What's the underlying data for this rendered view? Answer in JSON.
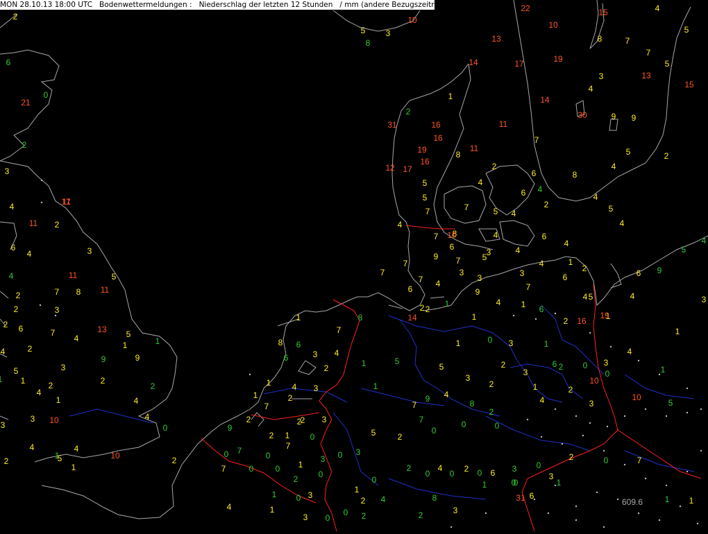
{
  "header": {
    "datetime": "MON 28.10.13 18:00 UTC",
    "report": "Bodenwettermeldungen :",
    "description": "Niederschlag der letzten 12 Stunden",
    "unit": "/ mm (andere Bezugszeiträume in GRAU)"
  },
  "colors": {
    "background": "#000000",
    "coastline": "#a8a8a8",
    "border_national": "#ff2020",
    "border_regional": "#2030c8",
    "low": "#33cc33",
    "mid": "#ffee22",
    "high": "#ff5522",
    "station_dot": "#bbbbbb",
    "grey": "#aaaaaa"
  },
  "station_values": [
    {
      "v": "2",
      "c": "mid"
    },
    {
      "v": "22",
      "c": "high"
    },
    {
      "v": "15",
      "c": "high"
    },
    {
      "v": "4",
      "c": "mid"
    },
    {
      "v": "10",
      "c": "high"
    },
    {
      "v": "5",
      "c": "mid"
    },
    {
      "v": "3",
      "c": "mid"
    },
    {
      "v": "8",
      "c": "low"
    },
    {
      "v": "6",
      "c": "low"
    },
    {
      "v": "5",
      "c": "mid"
    },
    {
      "v": "13",
      "c": "high"
    },
    {
      "v": "10",
      "c": "high"
    },
    {
      "v": "8",
      "c": "mid"
    },
    {
      "v": "7",
      "c": "mid"
    },
    {
      "v": "7",
      "c": "mid"
    },
    {
      "v": "5",
      "c": "mid"
    },
    {
      "v": "14",
      "c": "high"
    },
    {
      "v": "17",
      "c": "high"
    },
    {
      "v": "19",
      "c": "high"
    },
    {
      "v": "3",
      "c": "mid"
    },
    {
      "v": "13",
      "c": "high"
    },
    {
      "v": "4",
      "c": "mid"
    },
    {
      "v": "15",
      "c": "high"
    },
    {
      "v": "1",
      "c": "mid"
    },
    {
      "v": "14",
      "c": "high"
    },
    {
      "v": "21",
      "c": "high"
    },
    {
      "v": "0",
      "c": "low"
    },
    {
      "v": "2",
      "c": "low"
    },
    {
      "v": "30",
      "c": "high"
    },
    {
      "v": "9",
      "c": "mid"
    },
    {
      "v": "9",
      "c": "mid"
    },
    {
      "v": "7",
      "c": "mid"
    },
    {
      "v": "31",
      "c": "high"
    },
    {
      "v": "16",
      "c": "high"
    },
    {
      "v": "11",
      "c": "high"
    },
    {
      "v": "16",
      "c": "high"
    },
    {
      "v": "7",
      "c": "mid"
    },
    {
      "v": "2",
      "c": "low"
    },
    {
      "v": "19",
      "c": "high"
    },
    {
      "v": "11",
      "c": "high"
    },
    {
      "v": "5",
      "c": "mid"
    },
    {
      "v": "2",
      "c": "mid"
    },
    {
      "v": "8",
      "c": "mid"
    },
    {
      "v": "16",
      "c": "high"
    },
    {
      "v": "2",
      "c": "mid"
    },
    {
      "v": "12",
      "c": "high"
    },
    {
      "v": "17",
      "c": "high"
    },
    {
      "v": "4",
      "c": "mid"
    },
    {
      "v": "6",
      "c": "mid"
    },
    {
      "v": "8",
      "c": "mid"
    },
    {
      "v": "3",
      "c": "mid"
    },
    {
      "v": "17",
      "c": "high"
    },
    {
      "v": "5",
      "c": "mid"
    },
    {
      "v": "4",
      "c": "mid"
    },
    {
      "v": "6",
      "c": "mid"
    },
    {
      "v": "4",
      "c": "low"
    },
    {
      "v": "11",
      "c": "high"
    },
    {
      "v": "5",
      "c": "mid"
    },
    {
      "v": "2",
      "c": "mid"
    },
    {
      "v": "4",
      "c": "mid"
    },
    {
      "v": "4",
      "c": "mid"
    },
    {
      "v": "7",
      "c": "mid"
    },
    {
      "v": "5",
      "c": "mid"
    },
    {
      "v": "4",
      "c": "mid"
    },
    {
      "v": "7",
      "c": "mid"
    },
    {
      "v": "11",
      "c": "high"
    },
    {
      "v": "2",
      "c": "mid"
    },
    {
      "v": "5",
      "c": "mid"
    },
    {
      "v": "4",
      "c": "mid"
    },
    {
      "v": "4",
      "c": "mid"
    },
    {
      "v": "7",
      "c": "mid"
    },
    {
      "v": "8",
      "c": "mid"
    },
    {
      "v": "10",
      "c": "high"
    },
    {
      "v": "4",
      "c": "mid"
    },
    {
      "v": "6",
      "c": "mid"
    },
    {
      "v": "5",
      "c": "low"
    },
    {
      "v": "4",
      "c": "low"
    },
    {
      "v": "3",
      "c": "mid"
    },
    {
      "v": "6",
      "c": "mid"
    },
    {
      "v": "4",
      "c": "mid"
    },
    {
      "v": "9",
      "c": "mid"
    },
    {
      "v": "6",
      "c": "mid"
    },
    {
      "v": "7",
      "c": "mid"
    },
    {
      "v": "3",
      "c": "mid"
    },
    {
      "v": "4",
      "c": "mid"
    },
    {
      "v": "4",
      "c": "mid"
    },
    {
      "v": "1",
      "c": "mid"
    },
    {
      "v": "9",
      "c": "low"
    },
    {
      "v": "11",
      "c": "high"
    },
    {
      "v": "5",
      "c": "mid"
    },
    {
      "v": "7",
      "c": "mid"
    },
    {
      "v": "7",
      "c": "mid"
    },
    {
      "v": "5",
      "c": "mid"
    },
    {
      "v": "3",
      "c": "mid"
    },
    {
      "v": "4",
      "c": "mid"
    },
    {
      "v": "2",
      "c": "mid"
    },
    {
      "v": "4",
      "c": "low"
    },
    {
      "v": "2",
      "c": "mid"
    },
    {
      "v": "7",
      "c": "mid"
    },
    {
      "v": "8",
      "c": "mid"
    },
    {
      "v": "11",
      "c": "high"
    },
    {
      "v": "6",
      "c": "mid"
    },
    {
      "v": "7",
      "c": "mid"
    },
    {
      "v": "4",
      "c": "mid"
    },
    {
      "v": "3",
      "c": "mid"
    },
    {
      "v": "3",
      "c": "mid"
    },
    {
      "v": "2",
      "c": "mid"
    },
    {
      "v": "1",
      "c": "low"
    },
    {
      "v": "9",
      "c": "mid"
    },
    {
      "v": "4",
      "c": "mid"
    },
    {
      "v": "7",
      "c": "mid"
    },
    {
      "v": "6",
      "c": "mid"
    },
    {
      "v": "6",
      "c": "mid"
    },
    {
      "v": "4",
      "c": "mid"
    },
    {
      "v": "5",
      "c": "mid"
    },
    {
      "v": "4",
      "c": "mid"
    },
    {
      "v": "3",
      "c": "mid"
    },
    {
      "v": "2",
      "c": "mid"
    },
    {
      "v": "1",
      "c": "mid"
    },
    {
      "v": "6",
      "c": "low"
    },
    {
      "v": "7",
      "c": "mid"
    },
    {
      "v": "4",
      "c": "mid"
    },
    {
      "v": "13",
      "c": "high"
    },
    {
      "v": "2",
      "c": "mid"
    },
    {
      "v": "6",
      "c": "mid"
    },
    {
      "v": "3",
      "c": "mid"
    },
    {
      "v": "2",
      "c": "mid"
    },
    {
      "v": "2",
      "c": "mid"
    },
    {
      "v": "16",
      "c": "high"
    },
    {
      "v": "1",
      "c": "mid"
    },
    {
      "v": "5",
      "c": "mid"
    },
    {
      "v": "4",
      "c": "mid"
    },
    {
      "v": "1",
      "c": "mid"
    },
    {
      "v": "1",
      "c": "mid"
    },
    {
      "v": "2",
      "c": "mid"
    },
    {
      "v": "14",
      "c": "high"
    },
    {
      "v": "19",
      "c": "high"
    },
    {
      "v": "1",
      "c": "mid"
    },
    {
      "v": "1",
      "c": "low"
    },
    {
      "v": "8",
      "c": "low"
    },
    {
      "v": "7",
      "c": "mid"
    },
    {
      "v": "1",
      "c": "mid"
    },
    {
      "v": "8",
      "c": "mid"
    },
    {
      "v": "6",
      "c": "low"
    },
    {
      "v": "3",
      "c": "mid"
    },
    {
      "v": "4",
      "c": "mid"
    },
    {
      "v": "9",
      "c": "mid"
    },
    {
      "v": "2",
      "c": "low"
    },
    {
      "v": "9",
      "c": "low"
    },
    {
      "v": "3",
      "c": "mid"
    },
    {
      "v": "2",
      "c": "mid"
    },
    {
      "v": "1",
      "c": "mid"
    },
    {
      "v": "2",
      "c": "mid"
    },
    {
      "v": "5",
      "c": "mid"
    },
    {
      "v": "4",
      "c": "mid"
    },
    {
      "v": "1",
      "c": "mid"
    },
    {
      "v": "4",
      "c": "mid"
    },
    {
      "v": "1",
      "c": "low"
    },
    {
      "v": "6",
      "c": "low"
    },
    {
      "v": "1",
      "c": "mid"
    },
    {
      "v": "0",
      "c": "low"
    },
    {
      "v": "3",
      "c": "mid"
    },
    {
      "v": "1",
      "c": "low"
    },
    {
      "v": "4",
      "c": "mid"
    },
    {
      "v": "5",
      "c": "mid"
    },
    {
      "v": "2",
      "c": "mid"
    },
    {
      "v": "3",
      "c": "mid"
    },
    {
      "v": "6",
      "c": "low"
    },
    {
      "v": "2",
      "c": "mid"
    },
    {
      "v": "1",
      "c": "mid"
    },
    {
      "v": "4",
      "c": "mid"
    },
    {
      "v": "3",
      "c": "mid"
    },
    {
      "v": "1",
      "c": "low"
    },
    {
      "v": "5",
      "c": "low"
    },
    {
      "v": "1",
      "c": "low"
    },
    {
      "v": "3",
      "c": "mid"
    },
    {
      "v": "2",
      "c": "low"
    },
    {
      "v": "0",
      "c": "low"
    },
    {
      "v": "0",
      "c": "low"
    },
    {
      "v": "1",
      "c": "low"
    },
    {
      "v": "10",
      "c": "high"
    },
    {
      "v": "1",
      "c": "mid"
    },
    {
      "v": "2",
      "c": "mid"
    },
    {
      "v": "2",
      "c": "mid"
    },
    {
      "v": "3",
      "c": "mid"
    },
    {
      "v": "10",
      "c": "high"
    },
    {
      "v": "5",
      "c": "low"
    },
    {
      "v": "4",
      "c": "mid"
    },
    {
      "v": "8",
      "c": "low"
    },
    {
      "v": "7",
      "c": "mid"
    },
    {
      "v": "4",
      "c": "mid"
    },
    {
      "v": "9",
      "c": "low"
    },
    {
      "v": "1",
      "c": "mid"
    },
    {
      "v": "3",
      "c": "mid"
    },
    {
      "v": "2",
      "c": "mid"
    },
    {
      "v": "2",
      "c": "low"
    },
    {
      "v": "3",
      "c": "mid"
    },
    {
      "v": "3",
      "c": "mid"
    },
    {
      "v": "10",
      "c": "high"
    },
    {
      "v": "4",
      "c": "mid"
    },
    {
      "v": "0",
      "c": "low"
    },
    {
      "v": "2",
      "c": "mid"
    },
    {
      "v": "7",
      "c": "mid"
    },
    {
      "v": "2",
      "c": "mid"
    },
    {
      "v": "3",
      "c": "mid"
    },
    {
      "v": "2",
      "c": "mid"
    },
    {
      "v": "7",
      "c": "low"
    },
    {
      "v": "0",
      "c": "low"
    },
    {
      "v": "5",
      "c": "mid"
    },
    {
      "v": "0",
      "c": "low"
    },
    {
      "v": "0",
      "c": "low"
    },
    {
      "v": "9",
      "c": "low"
    },
    {
      "v": "2",
      "c": "mid"
    },
    {
      "v": "1",
      "c": "mid"
    },
    {
      "v": "2",
      "c": "mid"
    },
    {
      "v": "7",
      "c": "low"
    },
    {
      "v": "4",
      "c": "mid"
    },
    {
      "v": "4",
      "c": "mid"
    },
    {
      "v": "10",
      "c": "high"
    },
    {
      "v": "7",
      "c": "mid"
    },
    {
      "v": "0",
      "c": "low"
    },
    {
      "v": "3",
      "c": "low"
    },
    {
      "v": "0",
      "c": "low"
    },
    {
      "v": "3",
      "c": "low"
    },
    {
      "v": "0",
      "c": "low"
    },
    {
      "v": "0",
      "c": "low"
    },
    {
      "v": "0",
      "c": "low"
    },
    {
      "v": "1",
      "c": "mid"
    },
    {
      "v": "2",
      "c": "low"
    },
    {
      "v": "4",
      "c": "mid"
    },
    {
      "v": "2",
      "c": "mid"
    },
    {
      "v": "0",
      "c": "low"
    },
    {
      "v": "3",
      "c": "low"
    },
    {
      "v": "2",
      "c": "mid"
    },
    {
      "v": "0",
      "c": "low"
    },
    {
      "v": "0",
      "c": "low"
    },
    {
      "v": "7",
      "c": "mid"
    },
    {
      "v": "6",
      "c": "mid"
    },
    {
      "v": "3",
      "c": "mid"
    },
    {
      "v": "0",
      "c": "low"
    },
    {
      "v": "1",
      "c": "low"
    },
    {
      "v": "2",
      "c": "mid"
    },
    {
      "v": "5",
      "c": "mid"
    },
    {
      "v": "1",
      "c": "mid"
    },
    {
      "v": "2",
      "c": "mid"
    },
    {
      "v": "7",
      "c": "mid"
    },
    {
      "v": "0",
      "c": "low"
    },
    {
      "v": "2",
      "c": "low"
    },
    {
      "v": "0",
      "c": "low"
    },
    {
      "v": "1",
      "c": "low"
    },
    {
      "v": "0",
      "c": "low"
    },
    {
      "v": "0",
      "c": "low"
    },
    {
      "v": "0",
      "c": "low"
    },
    {
      "v": "1",
      "c": "low"
    },
    {
      "v": "0",
      "c": "low"
    },
    {
      "v": "3",
      "c": "mid"
    },
    {
      "v": "1",
      "c": "mid"
    },
    {
      "v": "4",
      "c": "low"
    },
    {
      "v": "8",
      "c": "low"
    },
    {
      "v": "31",
      "c": "high"
    },
    {
      "v": "6",
      "c": "mid"
    },
    {
      "v": "1",
      "c": "low"
    },
    {
      "v": "0",
      "c": "low"
    },
    {
      "v": "1",
      "c": "low"
    },
    {
      "v": "609.6",
      "c": "grey"
    },
    {
      "v": "1",
      "c": "mid"
    },
    {
      "v": "2",
      "c": "mid"
    },
    {
      "v": "4",
      "c": "mid"
    },
    {
      "v": "1",
      "c": "mid"
    },
    {
      "v": "3",
      "c": "mid"
    },
    {
      "v": "0",
      "c": "low"
    },
    {
      "v": "0",
      "c": "low"
    },
    {
      "v": "2",
      "c": "low"
    },
    {
      "v": "2",
      "c": "low"
    },
    {
      "v": "3",
      "c": "mid"
    }
  ]
}
